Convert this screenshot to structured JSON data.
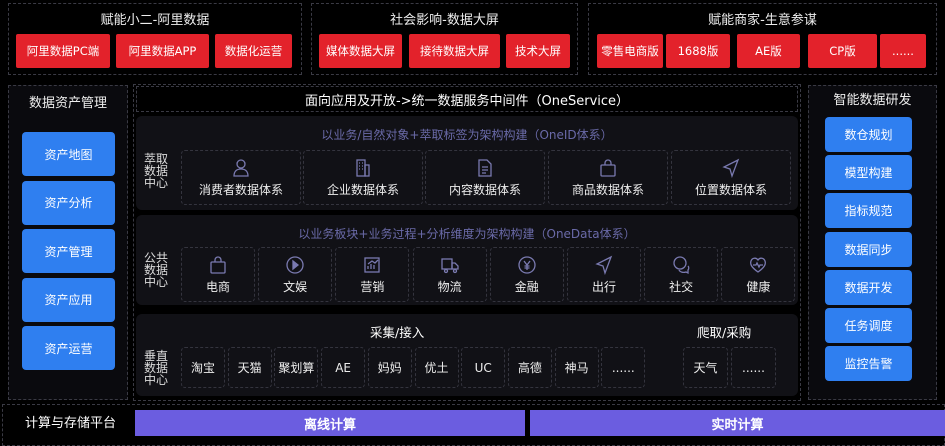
{
  "top": [
    {
      "title": "赋能小二-阿里数据",
      "buttons": [
        "阿里数据PC端",
        "阿里数据APP",
        "数据化运营"
      ]
    },
    {
      "title": "社会影响-数据大屏",
      "buttons": [
        "媒体数据大屏",
        "接待数据大屏",
        "技术大屏"
      ]
    },
    {
      "title": "赋能商家-生意参谋",
      "buttons": [
        "零售电商版",
        "1688版",
        "AE版",
        "CP版",
        "......"
      ]
    }
  ],
  "left": {
    "title": "数据资产管理",
    "items": [
      "资产地图",
      "资产分析",
      "资产管理",
      "资产应用",
      "资产运营"
    ]
  },
  "right": {
    "title": "智能数据研发",
    "items": [
      "数仓规划",
      "模型构建",
      "指标规范",
      "数据同步",
      "数据开发",
      "任务调度",
      "监控告警"
    ]
  },
  "oneservice": "面向应用及开放->统一数据服务中间件（OneService）",
  "oneid": {
    "subtitle": "以业务/自然对象+萃取标签为架构构建（OneID体系）",
    "label": "萃取数据中心",
    "cards": [
      {
        "icon": "user-icon",
        "label": "消费者数据体系"
      },
      {
        "icon": "building-icon",
        "label": "企业数据体系"
      },
      {
        "icon": "document-icon",
        "label": "内容数据体系"
      },
      {
        "icon": "bag-icon",
        "label": "商品数据体系"
      },
      {
        "icon": "location-arrow-icon",
        "label": "位置数据体系"
      }
    ]
  },
  "onedata": {
    "subtitle": "以业务板块+业务过程+分析维度为架构构建（OneData体系）",
    "label": "公共数据中心",
    "cards": [
      {
        "icon": "bag-icon",
        "label": "电商"
      },
      {
        "icon": "play-icon",
        "label": "文娱"
      },
      {
        "icon": "chart-icon",
        "label": "营销"
      },
      {
        "icon": "truck-icon",
        "label": "物流"
      },
      {
        "icon": "yen-icon",
        "label": "金融"
      },
      {
        "icon": "location-arrow-icon",
        "label": "出行"
      },
      {
        "icon": "chat-icon",
        "label": "社交"
      },
      {
        "icon": "heart-icon",
        "label": "健康"
      }
    ]
  },
  "vertical": {
    "label": "垂直数据中心",
    "collect_title": "采集/接入",
    "collect": [
      "淘宝",
      "天猫",
      "聚划算",
      "AE",
      "妈妈",
      "优土",
      "UC",
      "高德",
      "神马",
      "......"
    ],
    "crawl_title": "爬取/采购",
    "crawl": [
      "天气",
      "......"
    ]
  },
  "bottom": {
    "title": "计算与存储平台",
    "offline": "离线计算",
    "realtime": "实时计算"
  }
}
